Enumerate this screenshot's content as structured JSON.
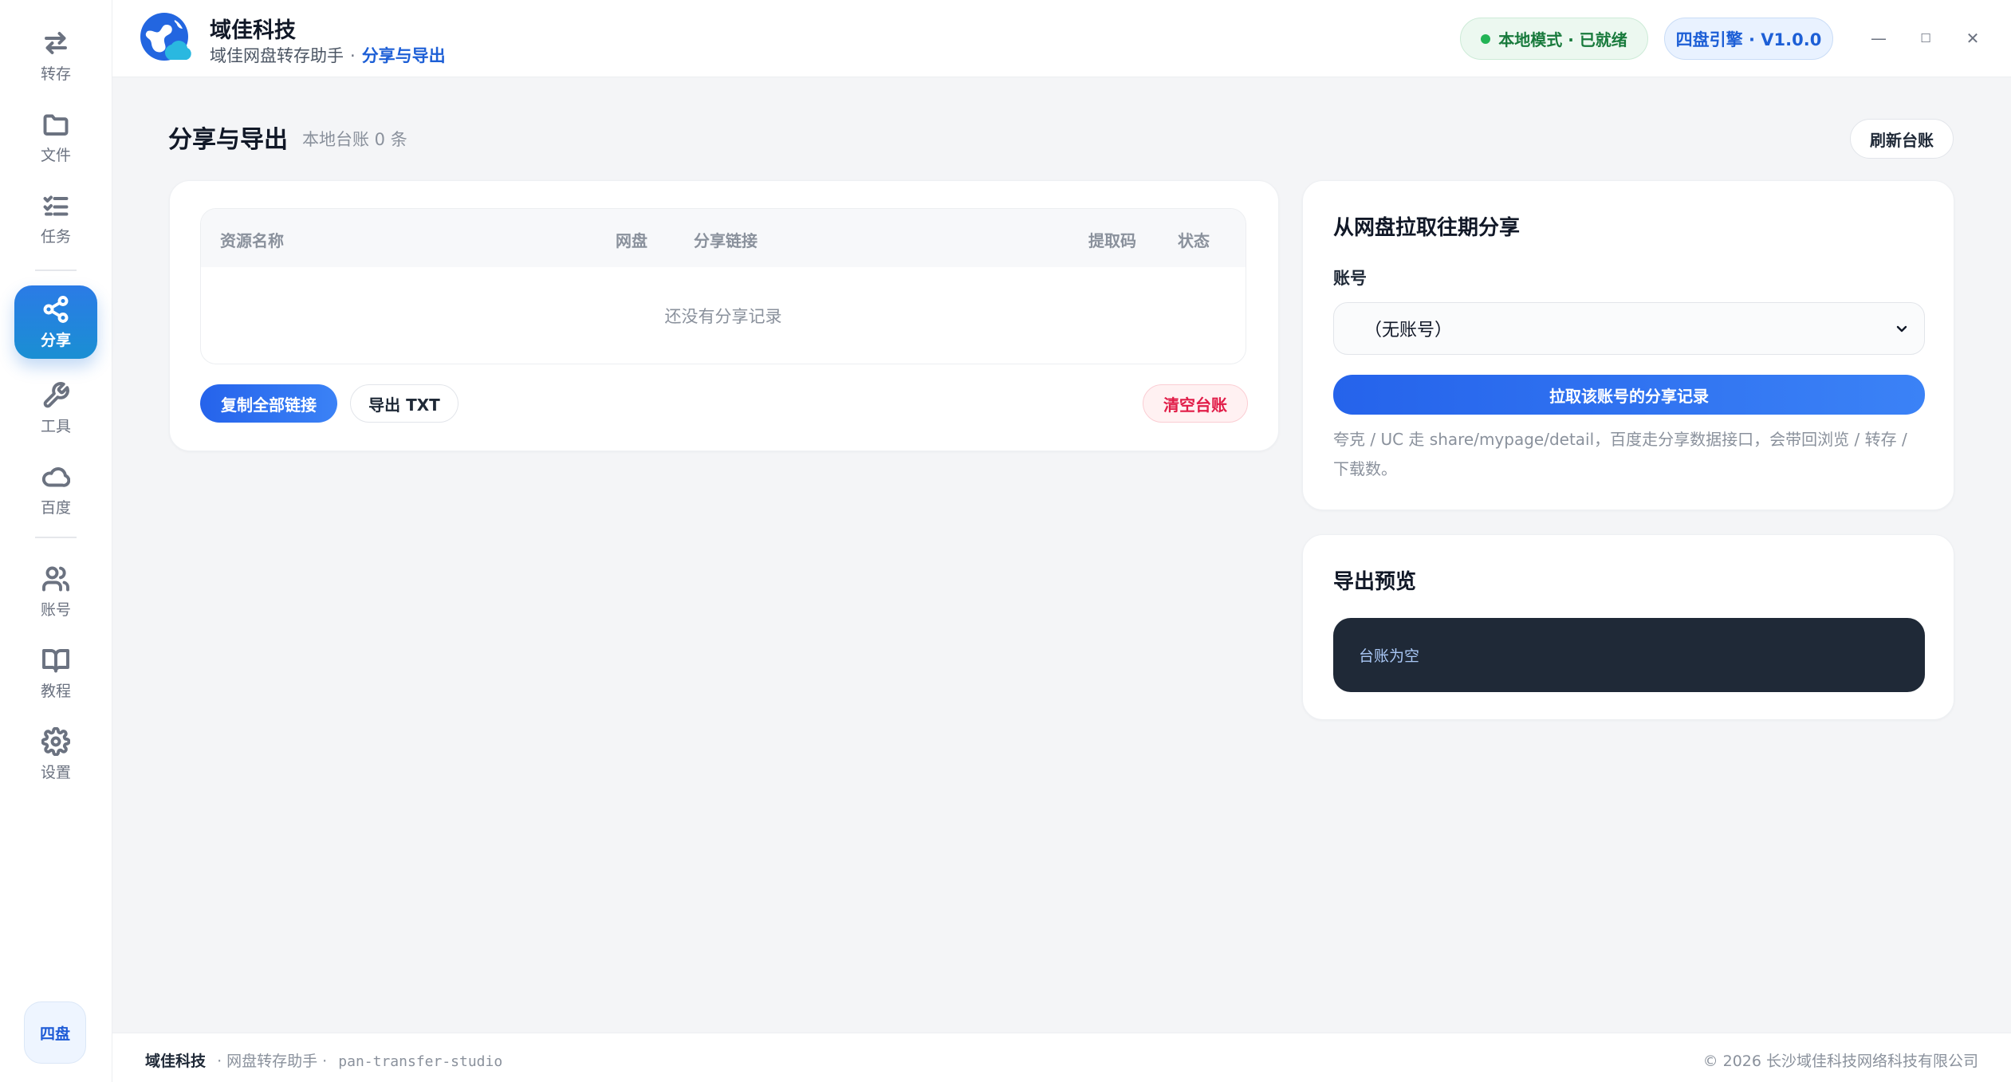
{
  "sidebar": {
    "items": [
      {
        "label": "转存",
        "icon": "transfer-icon"
      },
      {
        "label": "文件",
        "icon": "folder-icon"
      },
      {
        "label": "任务",
        "icon": "task-list-icon"
      },
      {
        "label": "分享",
        "icon": "share-icon",
        "active": true
      },
      {
        "label": "工具",
        "icon": "wrench-icon"
      },
      {
        "label": "百度",
        "icon": "cloud-icon"
      },
      {
        "label": "账号",
        "icon": "users-icon"
      },
      {
        "label": "教程",
        "icon": "book-icon"
      },
      {
        "label": "设置",
        "icon": "gear-icon"
      }
    ],
    "engine_chip": "四盘"
  },
  "header": {
    "app_title": "域佳科技",
    "breadcrumb_root": "域佳网盘转存助手",
    "breadcrumb_sep": "·",
    "breadcrumb_current": "分享与导出",
    "status": "本地模式 · 已就绪",
    "version": "四盘引擎 · V1.0.0",
    "window_controls": {
      "minimize": "—",
      "maximize": "☐",
      "close": "✕"
    }
  },
  "page": {
    "title": "分享与导出",
    "subtitle": "本地台账 0 条",
    "refresh_button": "刷新台账"
  },
  "ledger": {
    "columns": [
      "资源名称",
      "网盘",
      "分享链接",
      "提取码",
      "状态"
    ],
    "rows": [],
    "empty_text": "还没有分享记录",
    "copy_all_button": "复制全部链接",
    "export_button": "导出 TXT",
    "clear_button": "清空台账"
  },
  "pull_panel": {
    "title": "从网盘拉取往期分享",
    "account_label": "账号",
    "account_selected": "（无账号）",
    "pull_button": "拉取该账号的分享记录",
    "hint": "夸克 / UC 走 share/mypage/detail，百度走分享数据接口，会带回浏览 / 转存 / 下载数。"
  },
  "preview_panel": {
    "title": "导出预览",
    "content": "台账为空"
  },
  "footer": {
    "brand": "域佳科技",
    "product": "· 网盘转存助手 ·",
    "code": "pan-transfer-studio",
    "copyright": "© 2026 长沙域佳科技网络科技有限公司"
  },
  "colors": {
    "accent": "#2563eb",
    "success": "#22b455",
    "danger": "#e11d48",
    "preview_bg": "#1f2937"
  }
}
